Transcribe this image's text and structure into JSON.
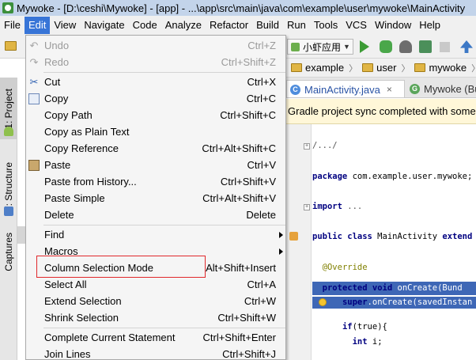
{
  "window": {
    "title": "Mywoke - [D:\\ceshi\\Mywoke] - [app] - ...\\app\\src\\main\\java\\com\\example\\user\\mywoke\\MainActivity"
  },
  "menubar": {
    "items": [
      {
        "label": "File",
        "mnemonic": "F",
        "rest": "ile"
      },
      {
        "label": "Edit",
        "mnemonic": "E",
        "rest": "dit",
        "active": true
      },
      {
        "label": "View",
        "mnemonic": "V",
        "rest": "iew"
      },
      {
        "label": "Navigate",
        "mnemonic": "N",
        "rest": "avigate"
      },
      {
        "label": "Code",
        "mnemonic": "C",
        "rest": "ode"
      },
      {
        "label": "Analyze",
        "mnemonic": "z",
        "rest": ""
      },
      {
        "label": "Refactor",
        "mnemonic": "R",
        "rest": "efactor"
      },
      {
        "label": "Build",
        "mnemonic": "B",
        "rest": "uild"
      },
      {
        "label": "Run",
        "mnemonic": "u",
        "rest": ""
      },
      {
        "label": "Tools",
        "mnemonic": "T",
        "rest": "ools"
      },
      {
        "label": "VCS",
        "mnemonic": "S",
        "rest": ""
      },
      {
        "label": "Window",
        "mnemonic": "W",
        "rest": "indow"
      },
      {
        "label": "Help",
        "mnemonic": "H",
        "rest": "elp"
      }
    ]
  },
  "toolbar": {
    "run_config": "小虾应用"
  },
  "breadcrumb": {
    "items": [
      "example",
      "user",
      "mywoke"
    ]
  },
  "tabs": {
    "active": "MainActivity.java",
    "inactive": "Mywoke (Bun"
  },
  "notice": {
    "text": "Gradle project sync completed with some"
  },
  "editor": {
    "lines": {
      "fold_import_1": "/.../",
      "package_kw": "package",
      "package_name": " com.example.user.mywoke;",
      "import_kw": "import",
      "import_fold": " ...",
      "class_kw": "public class",
      "class_name": " MainActivity ",
      "extends_kw": "extend",
      "override": "@Override",
      "protected_kw": "protected void",
      "oncreate": " onCreate(Bund",
      "super_kw": "super",
      "super_call": ".onCreate(savedInstan",
      "if_kw": "if",
      "if_rest": "(true){",
      "int_kw": "int",
      "int_rest": " i;"
    }
  },
  "left_strip": {
    "project": "1: Project",
    "structure": "7: Structure",
    "captures": "Captures"
  },
  "edit_menu": {
    "items": [
      {
        "label": "Undo",
        "mn": "U",
        "rest": "ndo",
        "shortcut": "Ctrl+Z",
        "disabled": true,
        "icon": "undo-icon"
      },
      {
        "label": "Redo",
        "mn": "R",
        "rest": "edo",
        "shortcut": "Ctrl+Shift+Z",
        "disabled": true,
        "icon": "redo-icon"
      },
      {
        "label": "Cut",
        "shortcut": "Ctrl+X",
        "icon": "cut-icon"
      },
      {
        "label": "Copy",
        "shortcut": "Ctrl+C",
        "icon": "copy-icon"
      },
      {
        "label": "Copy Path",
        "shortcut": "Ctrl+Shift+C"
      },
      {
        "label": "Copy as Plain Text",
        "shortcut": ""
      },
      {
        "label": "Copy Reference",
        "shortcut": "Ctrl+Alt+Shift+C"
      },
      {
        "label": "Paste",
        "shortcut": "Ctrl+V",
        "icon": "paste-icon"
      },
      {
        "label": "Paste from History...",
        "shortcut": "Ctrl+Shift+V"
      },
      {
        "label": "Paste Simple",
        "shortcut": "Ctrl+Alt+Shift+V"
      },
      {
        "label": "Delete",
        "shortcut": "Delete"
      },
      {
        "label": "Find",
        "shortcut": "",
        "submenu": true
      },
      {
        "label": "Macros",
        "shortcut": "",
        "submenu": true
      },
      {
        "label": "Column Selection Mode",
        "shortcut": "Alt+Shift+Insert"
      },
      {
        "label": "Select All",
        "shortcut": "Ctrl+A"
      },
      {
        "label": "Extend Selection",
        "shortcut": "Ctrl+W"
      },
      {
        "label": "Shrink Selection",
        "shortcut": "Ctrl+Shift+W"
      },
      {
        "label": "Complete Current Statement",
        "shortcut": "Ctrl+Shift+Enter"
      },
      {
        "label": "Join Lines",
        "shortcut": "Ctrl+Shift+J"
      }
    ]
  }
}
